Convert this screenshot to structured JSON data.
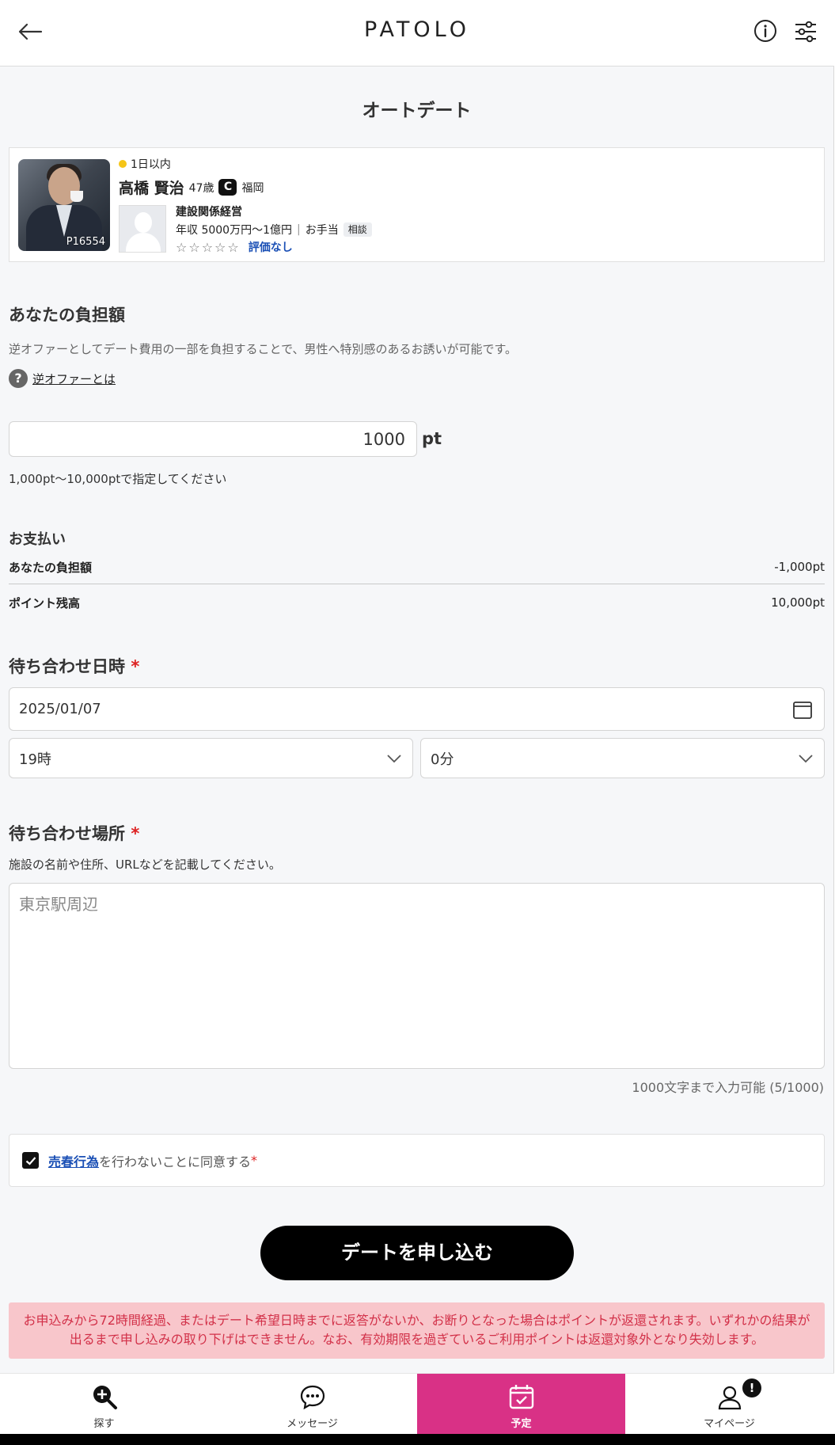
{
  "header": {
    "logo": "PATOLO",
    "title": "オートデート"
  },
  "profile": {
    "id_label": "P16554",
    "online": "1日以内",
    "name": "高橋 賢治",
    "age": "47歳",
    "rank": "C",
    "prefecture": "福岡",
    "job": "建設関係経営",
    "income": "年収 5000万円〜1億円",
    "allowance": "お手当",
    "allowance_tag": "相談",
    "stars": "☆☆☆☆☆",
    "rating": "評価なし"
  },
  "burden": {
    "title": "あなたの負担額",
    "description": "逆オファーとしてデート費用の一部を負担することで、男性へ特別感のあるお誘いが可能です。",
    "help_icon": "?",
    "help_link": "逆オファーとは",
    "value": "1000",
    "unit": "pt",
    "hint": "1,000pt〜10,000ptで指定してください"
  },
  "payment": {
    "title": "お支払い",
    "burden_label": "あなたの負担額",
    "burden_value": "-1,000pt",
    "balance_label": "ポイント残高",
    "balance_value": "10,000pt"
  },
  "meeting_time": {
    "title": "待ち合わせ日時",
    "required_mark": "*",
    "date": "2025/01/07",
    "hour": "19時",
    "minute": "0分"
  },
  "meeting_place": {
    "title": "待ち合わせ場所",
    "required_mark": "*",
    "description": "施設の名前や住所、URLなどを記載してください。",
    "value": "東京駅周辺",
    "counter": "1000文字まで入力可能 (5/1000)"
  },
  "agreement": {
    "link": "売春行為",
    "text": "を行わないことに同意する",
    "required_mark": "*",
    "checked": true
  },
  "submit_label": "デートを申し込む",
  "notice": "お申込みから72時間経過、またはデート希望日時までに返答がないか、お断りとなった場合はポイントが返還されます。いずれかの結果が出るまで申し込みの取り下げはできません。なお、有効期限を過ぎているご利用ポイントは返還対象外となり失効します。",
  "bottom_nav": {
    "items": [
      {
        "label": "探す",
        "icon": "search-plus-icon"
      },
      {
        "label": "メッセージ",
        "icon": "chat-icon"
      },
      {
        "label": "予定",
        "icon": "calendar-check-icon",
        "active": true
      },
      {
        "label": "マイページ",
        "icon": "user-icon",
        "badge": "!"
      }
    ]
  },
  "colors": {
    "accent": "#d93186",
    "notice_bg": "#f8c6cb",
    "notice_text": "#d23048",
    "link": "#1a4fb5",
    "online": "#f5c518"
  }
}
